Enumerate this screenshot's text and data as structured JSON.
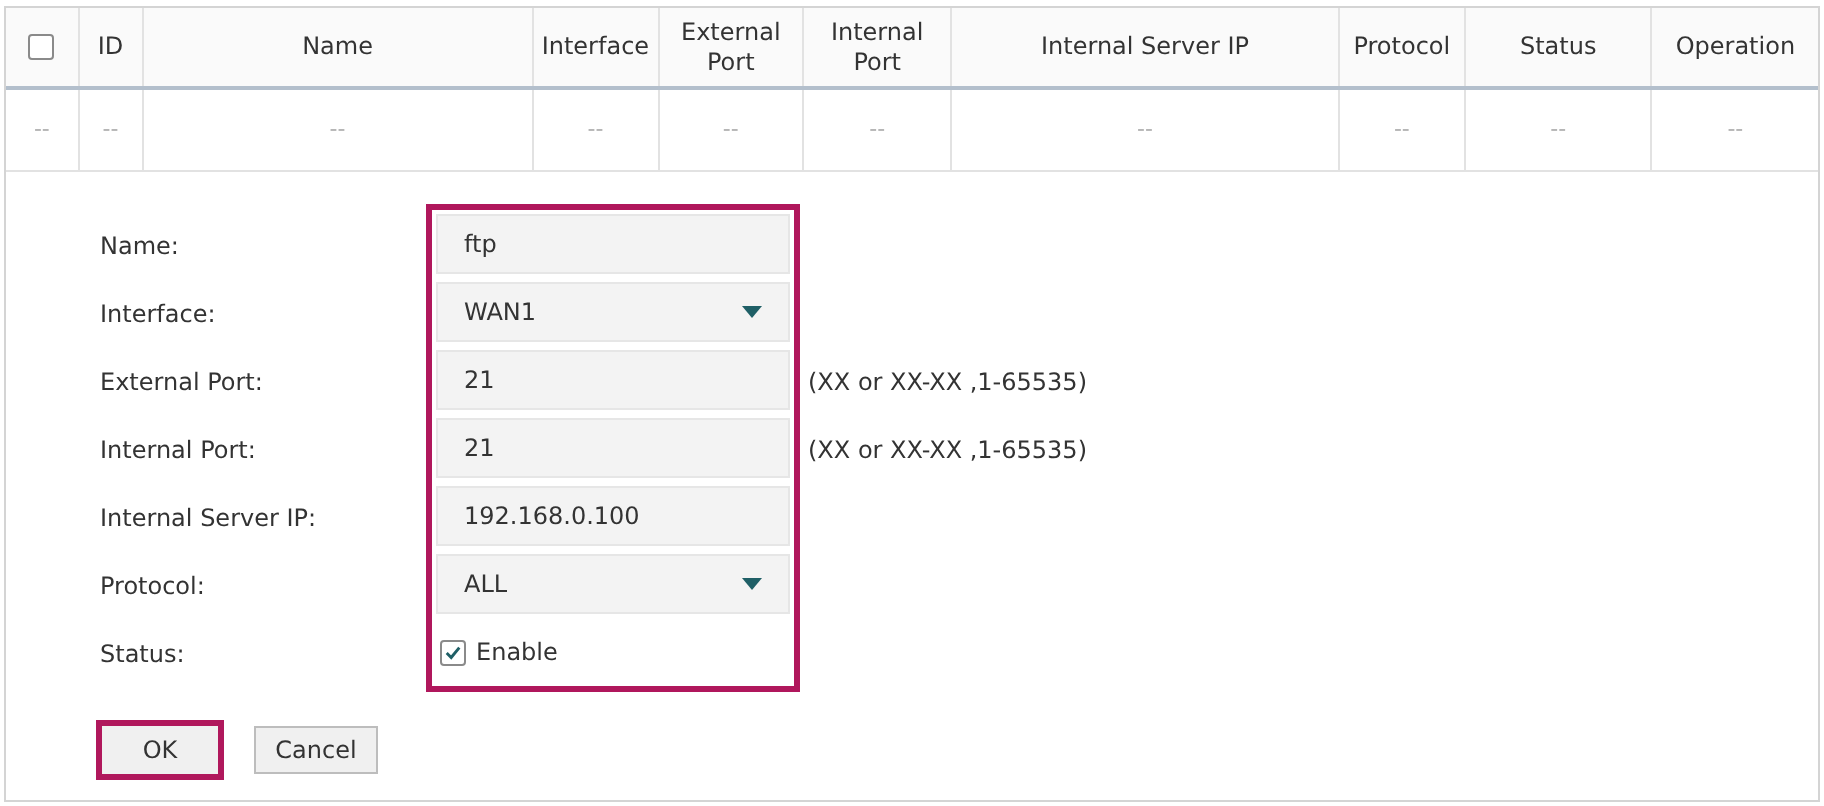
{
  "table": {
    "columns": [
      {
        "kind": "checkbox",
        "checked": false
      },
      {
        "kind": "text",
        "label": "ID"
      },
      {
        "kind": "text",
        "label": "Name"
      },
      {
        "kind": "text",
        "label": "Interface"
      },
      {
        "kind": "text",
        "label": "External Port"
      },
      {
        "kind": "text",
        "label": "Internal Port"
      },
      {
        "kind": "text",
        "label": "Internal Server IP"
      },
      {
        "kind": "text",
        "label": "Protocol"
      },
      {
        "kind": "text",
        "label": "Status"
      },
      {
        "kind": "text",
        "label": "Operation"
      }
    ],
    "rows": [
      [
        "--",
        "--",
        "--",
        "--",
        "--",
        "--",
        "--",
        "--",
        "--",
        "--"
      ]
    ]
  },
  "form": {
    "fields": [
      {
        "kind": "text",
        "label": "Name:",
        "value": "ftp"
      },
      {
        "kind": "select",
        "label": "Interface:",
        "value": "WAN1"
      },
      {
        "kind": "text",
        "label": "External Port:",
        "value": "21",
        "hint": "(XX or XX-XX ,1-65535)"
      },
      {
        "kind": "text",
        "label": "Internal Port:",
        "value": "21",
        "hint": "(XX or XX-XX ,1-65535)"
      },
      {
        "kind": "text",
        "label": "Internal Server IP:",
        "value": "192.168.0.100"
      },
      {
        "kind": "select",
        "label": "Protocol:",
        "value": "ALL"
      },
      {
        "kind": "checkbox",
        "label": "Status:",
        "value": "Enable",
        "checked": true
      }
    ],
    "buttons": [
      {
        "label": "OK",
        "highlighted": true
      },
      {
        "label": "Cancel",
        "highlighted": false
      }
    ]
  }
}
